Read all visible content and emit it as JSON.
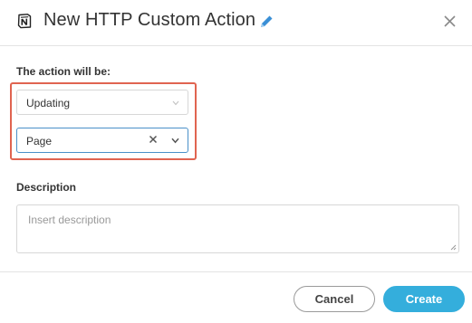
{
  "header": {
    "title": "New HTTP Custom Action",
    "logo_icon": "notion-logo-icon",
    "edit_icon": "pencil-icon",
    "close_icon": "close-icon"
  },
  "action": {
    "label": "The action will be:",
    "operation": {
      "value": "Updating",
      "icon": "chevron-down-icon"
    },
    "object": {
      "value": "Page",
      "clear_icon": "clear-icon",
      "icon": "chevron-down-icon"
    }
  },
  "description": {
    "label": "Description",
    "placeholder": "Insert description",
    "value": ""
  },
  "footer": {
    "cancel_label": "Cancel",
    "create_label": "Create"
  },
  "colors": {
    "accent": "#34aedc",
    "highlight": "#e06450",
    "focus_border": "#4a90c9",
    "edit_icon": "#3a8fd6"
  }
}
